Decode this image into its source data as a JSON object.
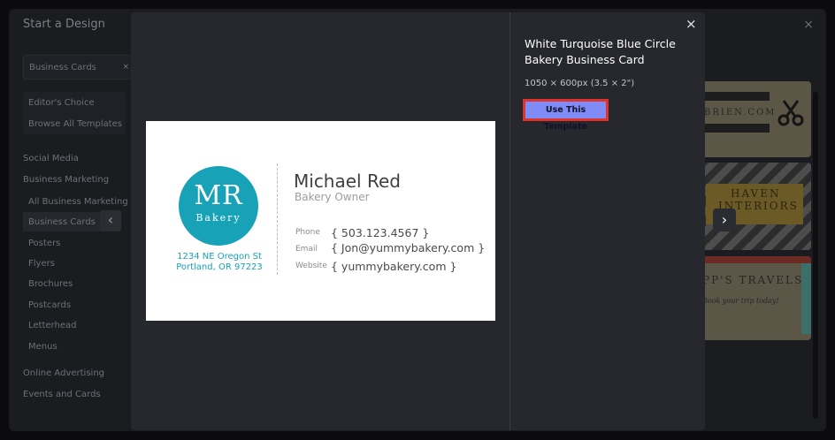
{
  "background": {
    "title": "Start a Design",
    "close_icon": "×",
    "search": {
      "value": "Business Cards",
      "clear_icon": "×"
    },
    "sidebar": {
      "editors_choice": "Editor's Choice",
      "browse_all": "Browse All Templates",
      "social_media": "Social Media",
      "business_marketing": "Business Marketing",
      "sub_items": [
        "All Business Marketing",
        "Business Cards",
        "Posters",
        "Flyers",
        "Brochures",
        "Postcards",
        "Letterhead",
        "Menus"
      ],
      "online_advertising": "Online Advertising",
      "events_and_cards": "Events and Cards"
    },
    "thumbs": {
      "t1": "BRIEN.COM",
      "t2a": "HAVEN",
      "t2b": "INTERIORS",
      "t3a": "PP'S TRAVELS",
      "t3b": "Book your trip today!"
    },
    "prev_icon": "‹",
    "next_icon": "›"
  },
  "modal": {
    "close_icon": "×",
    "template_title": "White Turquoise Blue Circle Bakery Business Card",
    "template_size": "1050 × 600px (3.5 × 2\")",
    "use_button": "Use This Template",
    "card": {
      "logo_initials": "MR",
      "logo_word": "Bakery",
      "address_line1": "1234 NE Oregon St",
      "address_line2": "Portland, OR 97223",
      "name": "Michael Red",
      "role": "Bakery Owner",
      "phone_label": "Phone",
      "phone_value": "{ 503.123.4567 }",
      "email_label": "Email",
      "email_value": "{ Jon@yummybakery.com }",
      "website_label": "Website",
      "website_value": "{ yummybakery.com }"
    }
  },
  "colors": {
    "accent_button": "#7f8bf6",
    "highlight_border": "#e0322b",
    "brand_teal": "#18a2b8"
  }
}
